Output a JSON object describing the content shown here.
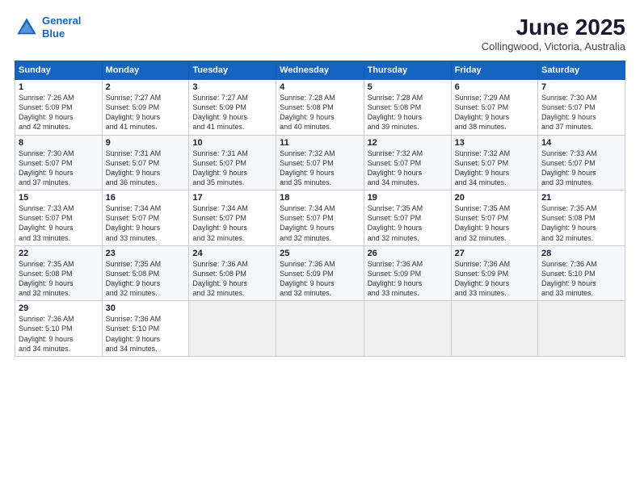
{
  "header": {
    "logo_line1": "General",
    "logo_line2": "Blue",
    "month_title": "June 2025",
    "subtitle": "Collingwood, Victoria, Australia"
  },
  "weekdays": [
    "Sunday",
    "Monday",
    "Tuesday",
    "Wednesday",
    "Thursday",
    "Friday",
    "Saturday"
  ],
  "weeks": [
    [
      {
        "day": "1",
        "info": "Sunrise: 7:26 AM\nSunset: 5:09 PM\nDaylight: 9 hours\nand 42 minutes."
      },
      {
        "day": "2",
        "info": "Sunrise: 7:27 AM\nSunset: 5:09 PM\nDaylight: 9 hours\nand 41 minutes."
      },
      {
        "day": "3",
        "info": "Sunrise: 7:27 AM\nSunset: 5:09 PM\nDaylight: 9 hours\nand 41 minutes."
      },
      {
        "day": "4",
        "info": "Sunrise: 7:28 AM\nSunset: 5:08 PM\nDaylight: 9 hours\nand 40 minutes."
      },
      {
        "day": "5",
        "info": "Sunrise: 7:28 AM\nSunset: 5:08 PM\nDaylight: 9 hours\nand 39 minutes."
      },
      {
        "day": "6",
        "info": "Sunrise: 7:29 AM\nSunset: 5:07 PM\nDaylight: 9 hours\nand 38 minutes."
      },
      {
        "day": "7",
        "info": "Sunrise: 7:30 AM\nSunset: 5:07 PM\nDaylight: 9 hours\nand 37 minutes."
      }
    ],
    [
      {
        "day": "8",
        "info": "Sunrise: 7:30 AM\nSunset: 5:07 PM\nDaylight: 9 hours\nand 37 minutes."
      },
      {
        "day": "9",
        "info": "Sunrise: 7:31 AM\nSunset: 5:07 PM\nDaylight: 9 hours\nand 36 minutes."
      },
      {
        "day": "10",
        "info": "Sunrise: 7:31 AM\nSunset: 5:07 PM\nDaylight: 9 hours\nand 35 minutes."
      },
      {
        "day": "11",
        "info": "Sunrise: 7:32 AM\nSunset: 5:07 PM\nDaylight: 9 hours\nand 35 minutes."
      },
      {
        "day": "12",
        "info": "Sunrise: 7:32 AM\nSunset: 5:07 PM\nDaylight: 9 hours\nand 34 minutes."
      },
      {
        "day": "13",
        "info": "Sunrise: 7:32 AM\nSunset: 5:07 PM\nDaylight: 9 hours\nand 34 minutes."
      },
      {
        "day": "14",
        "info": "Sunrise: 7:33 AM\nSunset: 5:07 PM\nDaylight: 9 hours\nand 33 minutes."
      }
    ],
    [
      {
        "day": "15",
        "info": "Sunrise: 7:33 AM\nSunset: 5:07 PM\nDaylight: 9 hours\nand 33 minutes."
      },
      {
        "day": "16",
        "info": "Sunrise: 7:34 AM\nSunset: 5:07 PM\nDaylight: 9 hours\nand 33 minutes."
      },
      {
        "day": "17",
        "info": "Sunrise: 7:34 AM\nSunset: 5:07 PM\nDaylight: 9 hours\nand 32 minutes."
      },
      {
        "day": "18",
        "info": "Sunrise: 7:34 AM\nSunset: 5:07 PM\nDaylight: 9 hours\nand 32 minutes."
      },
      {
        "day": "19",
        "info": "Sunrise: 7:35 AM\nSunset: 5:07 PM\nDaylight: 9 hours\nand 32 minutes."
      },
      {
        "day": "20",
        "info": "Sunrise: 7:35 AM\nSunset: 5:07 PM\nDaylight: 9 hours\nand 32 minutes."
      },
      {
        "day": "21",
        "info": "Sunrise: 7:35 AM\nSunset: 5:08 PM\nDaylight: 9 hours\nand 32 minutes."
      }
    ],
    [
      {
        "day": "22",
        "info": "Sunrise: 7:35 AM\nSunset: 5:08 PM\nDaylight: 9 hours\nand 32 minutes."
      },
      {
        "day": "23",
        "info": "Sunrise: 7:35 AM\nSunset: 5:08 PM\nDaylight: 9 hours\nand 32 minutes."
      },
      {
        "day": "24",
        "info": "Sunrise: 7:36 AM\nSunset: 5:08 PM\nDaylight: 9 hours\nand 32 minutes."
      },
      {
        "day": "25",
        "info": "Sunrise: 7:36 AM\nSunset: 5:09 PM\nDaylight: 9 hours\nand 32 minutes."
      },
      {
        "day": "26",
        "info": "Sunrise: 7:36 AM\nSunset: 5:09 PM\nDaylight: 9 hours\nand 33 minutes."
      },
      {
        "day": "27",
        "info": "Sunrise: 7:36 AM\nSunset: 5:09 PM\nDaylight: 9 hours\nand 33 minutes."
      },
      {
        "day": "28",
        "info": "Sunrise: 7:36 AM\nSunset: 5:10 PM\nDaylight: 9 hours\nand 33 minutes."
      }
    ],
    [
      {
        "day": "29",
        "info": "Sunrise: 7:36 AM\nSunset: 5:10 PM\nDaylight: 9 hours\nand 34 minutes."
      },
      {
        "day": "30",
        "info": "Sunrise: 7:36 AM\nSunset: 5:10 PM\nDaylight: 9 hours\nand 34 minutes."
      },
      {
        "day": "",
        "info": ""
      },
      {
        "day": "",
        "info": ""
      },
      {
        "day": "",
        "info": ""
      },
      {
        "day": "",
        "info": ""
      },
      {
        "day": "",
        "info": ""
      }
    ]
  ]
}
